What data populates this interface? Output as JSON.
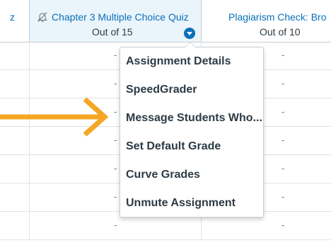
{
  "columns": {
    "left": {
      "title_fragment": "z"
    },
    "assignment": {
      "title": "Chapter 3 Multiple Choice Quiz",
      "points": "Out of 15",
      "icon": "muted-bell-icon",
      "options_icon": "column-options-icon"
    },
    "right": {
      "title": "Plagiarism Check: Bro",
      "points": "Out of 10"
    }
  },
  "rows": [
    {
      "assignment": "-",
      "right": "-"
    },
    {
      "assignment": "-",
      "right": "-"
    },
    {
      "assignment": "-",
      "right": "-"
    },
    {
      "assignment": "-",
      "right": "-"
    },
    {
      "assignment": "-",
      "right": "-"
    },
    {
      "assignment": "-",
      "right": "-"
    },
    {
      "assignment": "-",
      "right": "-"
    }
  ],
  "menu": {
    "items": [
      "Assignment Details",
      "SpeedGrader",
      "Message Students Who...",
      "Set Default Grade",
      "Curve Grades",
      "Unmute Assignment"
    ]
  },
  "annotation": {
    "arrow_icon": "arrow-right-icon",
    "arrow_color": "#f5a623"
  },
  "colors": {
    "link": "#0a70b9",
    "header_highlight": "#eaf4fb",
    "text": "#2d3b45"
  }
}
